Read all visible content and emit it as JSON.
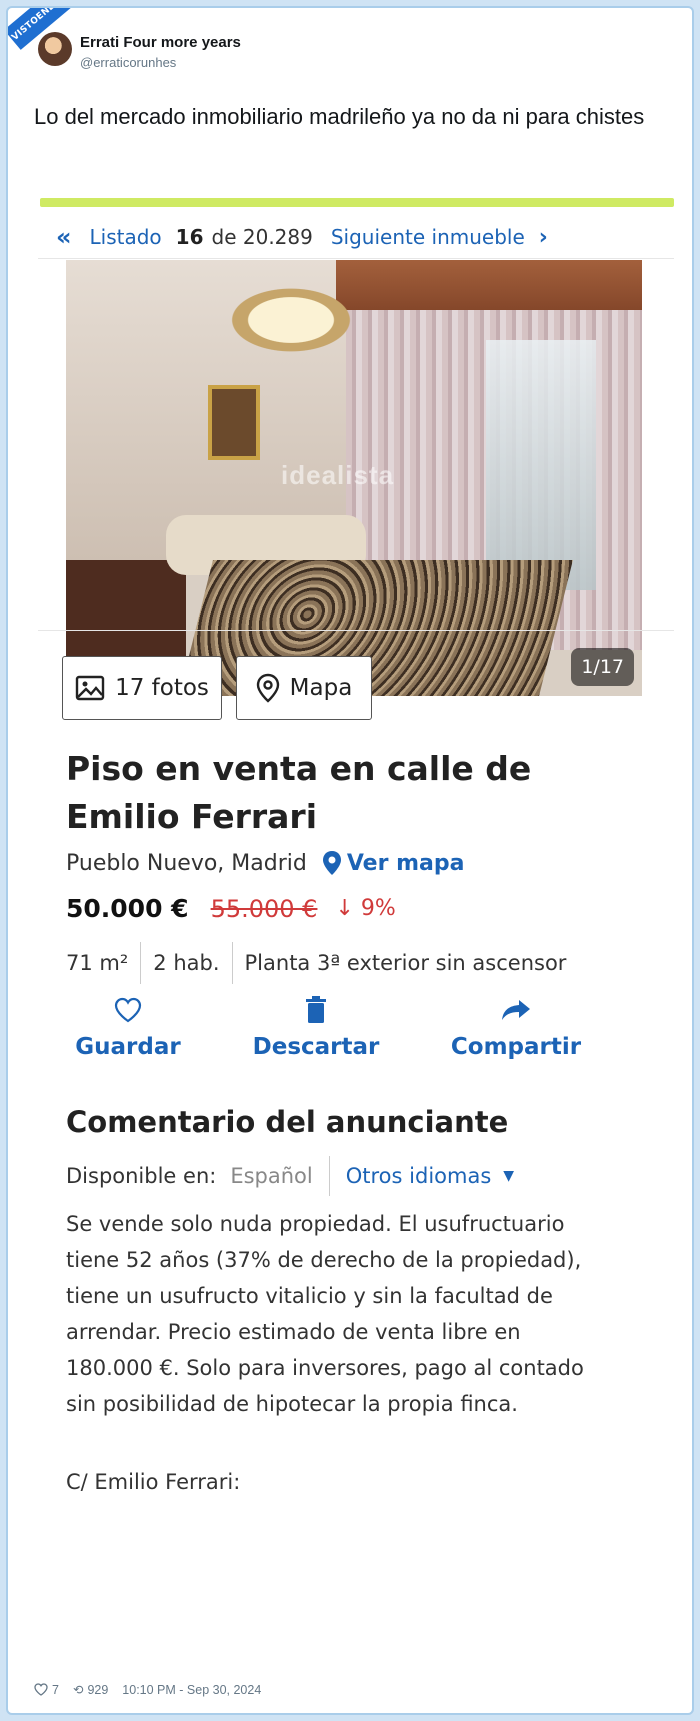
{
  "watermark_ribbon": "VISTOENLASREDES",
  "tweet": {
    "author_name": "Errati Four more years",
    "author_handle": "@erraticorunhes",
    "text": "Lo del mercado inmobiliario madrileño ya no da ni para chistes",
    "likes": "7",
    "retweets": "929",
    "timestamp": "10:10 PM - Sep 30, 2024"
  },
  "listing": {
    "nav": {
      "back_label": "Listado",
      "current": "16",
      "of_label": "de 20.289",
      "next_label": "Siguiente inmueble"
    },
    "photo": {
      "watermark": "idealista",
      "counter": "1/17"
    },
    "buttons": {
      "photos_label": "17 fotos",
      "map_label": "Mapa"
    },
    "title_line1": "Piso en venta en calle de",
    "title_line2": "Emilio Ferrari",
    "location": "Pueblo Nuevo, Madrid",
    "see_map": "Ver mapa",
    "price": "50.000 €",
    "old_price": "55.000 €",
    "price_drop": "↓ 9%",
    "features": [
      "71 m²",
      "2 hab.",
      "Planta 3ª exterior sin ascensor"
    ],
    "actions": {
      "save": "Guardar",
      "discard": "Descartar",
      "share": "Compartir"
    },
    "comment_title": "Comentario del anunciante",
    "available_in": "Disponible en:",
    "current_language": "Español",
    "other_languages": "Otros idiomas",
    "comment": "Se vende solo nuda propiedad. El usufructuario\ntiene 52 años (37% de derecho de la propiedad),\ntiene un usufructo vitalicio y sin la facultad de\narrendar. Precio estimado de venta libre en\n180.000 €. Solo para inversores, pago al contado\nsin posibilidad de hipotecar la propia finca.",
    "address": "C/ Emilio Ferrari:"
  },
  "colors": {
    "accent_blue": "#1c63b5",
    "price_drop_red": "#d03a3a",
    "lime_bar": "#cfea63"
  }
}
